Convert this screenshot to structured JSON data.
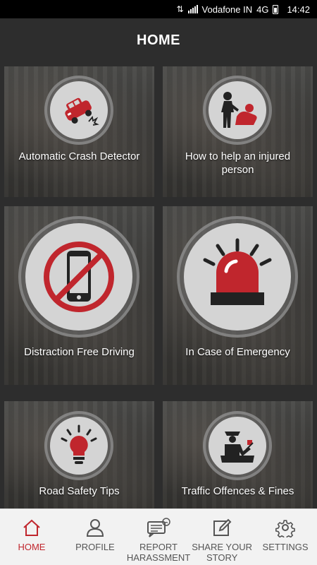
{
  "status_bar": {
    "carrier": "Vodafone IN",
    "network": "4G",
    "time": "14:42"
  },
  "header": {
    "title": "HOME"
  },
  "tiles": [
    {
      "label": "Automatic Crash Detector",
      "icon": "car-crash-icon"
    },
    {
      "label": "How to help an injured person",
      "icon": "first-aid-helper-icon"
    },
    {
      "label": "Distraction Free Driving",
      "icon": "no-phone-icon"
    },
    {
      "label": "In Case of Emergency",
      "icon": "siren-icon"
    },
    {
      "label": "Road Safety Tips",
      "icon": "lightbulb-icon"
    },
    {
      "label": "Traffic Offences & Fines",
      "icon": "traffic-police-icon"
    }
  ],
  "bottom_nav": {
    "items": [
      {
        "label": "HOME",
        "icon": "home-icon",
        "active": true
      },
      {
        "label": "PROFILE",
        "icon": "profile-icon"
      },
      {
        "label": "REPORT HARASSMENT",
        "icon": "report-chat-icon"
      },
      {
        "label": "SHARE YOUR STORY",
        "icon": "edit-note-icon"
      },
      {
        "label": "SETTINGS",
        "icon": "gear-icon"
      }
    ]
  },
  "colors": {
    "accent": "#c0262d",
    "header_bg": "#2d2d2d",
    "nav_bg": "#f2f2f2"
  }
}
